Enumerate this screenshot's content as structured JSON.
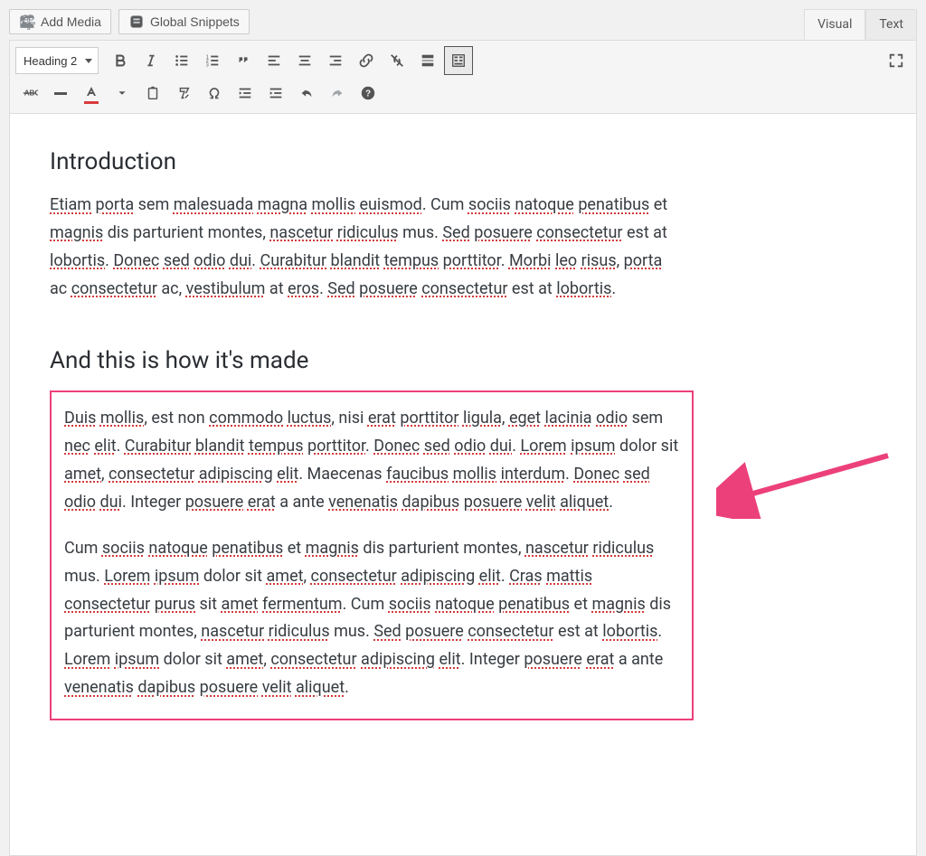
{
  "topbar": {
    "add_media": "Add Media",
    "global_snippets": "Global Snippets"
  },
  "tabs": {
    "visual": "Visual",
    "text": "Text"
  },
  "toolbar": {
    "format": "Heading 2"
  },
  "content": {
    "h1": "Introduction",
    "p1_parts": [
      {
        "t": "Etiam",
        "s": 1
      },
      {
        "t": " ",
        "s": 0
      },
      {
        "t": "porta",
        "s": 1
      },
      {
        "t": " sem ",
        "s": 0
      },
      {
        "t": "malesuada",
        "s": 1
      },
      {
        "t": " ",
        "s": 0
      },
      {
        "t": "magna",
        "s": 1
      },
      {
        "t": " ",
        "s": 0
      },
      {
        "t": "mollis",
        "s": 1
      },
      {
        "t": " ",
        "s": 0
      },
      {
        "t": "euismod",
        "s": 1
      },
      {
        "t": ". Cum ",
        "s": 0
      },
      {
        "t": "sociis",
        "s": 1
      },
      {
        "t": " ",
        "s": 0
      },
      {
        "t": "natoque",
        "s": 1
      },
      {
        "t": " ",
        "s": 0
      },
      {
        "t": "penatibus",
        "s": 1
      },
      {
        "t": " et ",
        "s": 0
      },
      {
        "t": "magnis",
        "s": 1
      },
      {
        "t": " dis parturient montes, ",
        "s": 0
      },
      {
        "t": "nascetur",
        "s": 1
      },
      {
        "t": " ",
        "s": 0
      },
      {
        "t": "ridiculus",
        "s": 1
      },
      {
        "t": " mus. ",
        "s": 0
      },
      {
        "t": "Sed",
        "s": 1
      },
      {
        "t": " ",
        "s": 0
      },
      {
        "t": "posuere",
        "s": 1
      },
      {
        "t": " ",
        "s": 0
      },
      {
        "t": "consectetur",
        "s": 1
      },
      {
        "t": " est at ",
        "s": 0
      },
      {
        "t": "lobortis",
        "s": 1
      },
      {
        "t": ". ",
        "s": 0
      },
      {
        "t": "Donec",
        "s": 1
      },
      {
        "t": " ",
        "s": 0
      },
      {
        "t": "sed",
        "s": 1
      },
      {
        "t": " ",
        "s": 0
      },
      {
        "t": "odio",
        "s": 1
      },
      {
        "t": " ",
        "s": 0
      },
      {
        "t": "dui",
        "s": 1
      },
      {
        "t": ". ",
        "s": 0
      },
      {
        "t": "Curabitur",
        "s": 1
      },
      {
        "t": " ",
        "s": 0
      },
      {
        "t": "blandit",
        "s": 1
      },
      {
        "t": " ",
        "s": 0
      },
      {
        "t": "tempus",
        "s": 1
      },
      {
        "t": " ",
        "s": 0
      },
      {
        "t": "porttitor",
        "s": 1
      },
      {
        "t": ". ",
        "s": 0
      },
      {
        "t": "Morbi",
        "s": 1
      },
      {
        "t": " ",
        "s": 0
      },
      {
        "t": "leo",
        "s": 1
      },
      {
        "t": " ",
        "s": 0
      },
      {
        "t": "risus",
        "s": 1
      },
      {
        "t": ", ",
        "s": 0
      },
      {
        "t": "porta",
        "s": 1
      },
      {
        "t": " ac ",
        "s": 0
      },
      {
        "t": "consectetur",
        "s": 1
      },
      {
        "t": " ac, ",
        "s": 0
      },
      {
        "t": "vestibulum",
        "s": 1
      },
      {
        "t": " at ",
        "s": 0
      },
      {
        "t": "eros",
        "s": 1
      },
      {
        "t": ". ",
        "s": 0
      },
      {
        "t": "Sed",
        "s": 1
      },
      {
        "t": " ",
        "s": 0
      },
      {
        "t": "posuere",
        "s": 1
      },
      {
        "t": " ",
        "s": 0
      },
      {
        "t": "consectetur",
        "s": 1
      },
      {
        "t": " est at ",
        "s": 0
      },
      {
        "t": "lobortis",
        "s": 1
      },
      {
        "t": ".",
        "s": 0
      }
    ],
    "h2": "And this is how it's made",
    "p2_parts": [
      {
        "t": "Duis",
        "s": 1
      },
      {
        "t": " ",
        "s": 0
      },
      {
        "t": "mollis",
        "s": 1
      },
      {
        "t": ", est non ",
        "s": 0
      },
      {
        "t": "commodo",
        "s": 1
      },
      {
        "t": " ",
        "s": 0
      },
      {
        "t": "luctus",
        "s": 1
      },
      {
        "t": ", nisi ",
        "s": 0
      },
      {
        "t": "erat",
        "s": 1
      },
      {
        "t": " ",
        "s": 0
      },
      {
        "t": "porttitor",
        "s": 1
      },
      {
        "t": " ",
        "s": 0
      },
      {
        "t": "ligula",
        "s": 1
      },
      {
        "t": ", ",
        "s": 0
      },
      {
        "t": "eget",
        "s": 1
      },
      {
        "t": " ",
        "s": 0
      },
      {
        "t": "lacinia",
        "s": 1
      },
      {
        "t": " ",
        "s": 0
      },
      {
        "t": "odio",
        "s": 1
      },
      {
        "t": " sem ",
        "s": 0
      },
      {
        "t": "nec",
        "s": 1
      },
      {
        "t": " ",
        "s": 0
      },
      {
        "t": "elit",
        "s": 1
      },
      {
        "t": ". ",
        "s": 0
      },
      {
        "t": "Curabitur",
        "s": 1
      },
      {
        "t": " ",
        "s": 0
      },
      {
        "t": "blandit",
        "s": 1
      },
      {
        "t": " ",
        "s": 0
      },
      {
        "t": "tempus",
        "s": 1
      },
      {
        "t": " ",
        "s": 0
      },
      {
        "t": "porttitor",
        "s": 1
      },
      {
        "t": ". ",
        "s": 0
      },
      {
        "t": "Donec",
        "s": 1
      },
      {
        "t": " ",
        "s": 0
      },
      {
        "t": "sed",
        "s": 1
      },
      {
        "t": " ",
        "s": 0
      },
      {
        "t": "odio",
        "s": 1
      },
      {
        "t": " ",
        "s": 0
      },
      {
        "t": "dui",
        "s": 1
      },
      {
        "t": ". ",
        "s": 0
      },
      {
        "t": "Lorem",
        "s": 1
      },
      {
        "t": " ",
        "s": 0
      },
      {
        "t": "ipsum",
        "s": 1
      },
      {
        "t": " dolor sit ",
        "s": 0
      },
      {
        "t": "amet",
        "s": 1
      },
      {
        "t": ", ",
        "s": 0
      },
      {
        "t": "consectetur",
        "s": 1
      },
      {
        "t": " ",
        "s": 0
      },
      {
        "t": "adipiscing",
        "s": 1
      },
      {
        "t": " ",
        "s": 0
      },
      {
        "t": "elit",
        "s": 1
      },
      {
        "t": ". Maecenas ",
        "s": 0
      },
      {
        "t": "faucibus",
        "s": 1
      },
      {
        "t": " ",
        "s": 0
      },
      {
        "t": "mollis",
        "s": 1
      },
      {
        "t": " ",
        "s": 0
      },
      {
        "t": "interdum",
        "s": 1
      },
      {
        "t": ". ",
        "s": 0
      },
      {
        "t": "Donec",
        "s": 1
      },
      {
        "t": " ",
        "s": 0
      },
      {
        "t": "sed",
        "s": 1
      },
      {
        "t": " ",
        "s": 0
      },
      {
        "t": "odio",
        "s": 1
      },
      {
        "t": " ",
        "s": 0
      },
      {
        "t": "dui",
        "s": 1
      },
      {
        "t": ". Integer ",
        "s": 0
      },
      {
        "t": "posuere",
        "s": 1
      },
      {
        "t": " ",
        "s": 0
      },
      {
        "t": "erat",
        "s": 1
      },
      {
        "t": " a ante ",
        "s": 0
      },
      {
        "t": "venenatis",
        "s": 1
      },
      {
        "t": " ",
        "s": 0
      },
      {
        "t": "dapibus",
        "s": 1
      },
      {
        "t": " ",
        "s": 0
      },
      {
        "t": "posuere",
        "s": 1
      },
      {
        "t": " ",
        "s": 0
      },
      {
        "t": "velit",
        "s": 1
      },
      {
        "t": " ",
        "s": 0
      },
      {
        "t": "aliquet",
        "s": 1
      },
      {
        "t": ".",
        "s": 0
      }
    ],
    "p3_parts": [
      {
        "t": "Cum ",
        "s": 0
      },
      {
        "t": "sociis",
        "s": 1
      },
      {
        "t": " ",
        "s": 0
      },
      {
        "t": "natoque",
        "s": 1
      },
      {
        "t": " ",
        "s": 0
      },
      {
        "t": "penatibus",
        "s": 1
      },
      {
        "t": " et ",
        "s": 0
      },
      {
        "t": "magnis",
        "s": 1
      },
      {
        "t": " dis parturient montes, ",
        "s": 0
      },
      {
        "t": "nascetur",
        "s": 1
      },
      {
        "t": " ",
        "s": 0
      },
      {
        "t": "ridiculus",
        "s": 1
      },
      {
        "t": " mus. ",
        "s": 0
      },
      {
        "t": "Lorem",
        "s": 1
      },
      {
        "t": " ",
        "s": 0
      },
      {
        "t": "ipsum",
        "s": 1
      },
      {
        "t": " dolor sit ",
        "s": 0
      },
      {
        "t": "amet",
        "s": 1
      },
      {
        "t": ", ",
        "s": 0
      },
      {
        "t": "consectetur",
        "s": 1
      },
      {
        "t": " ",
        "s": 0
      },
      {
        "t": "adipiscing",
        "s": 1
      },
      {
        "t": " ",
        "s": 0
      },
      {
        "t": "elit",
        "s": 1
      },
      {
        "t": ". ",
        "s": 0
      },
      {
        "t": "Cras",
        "s": 1
      },
      {
        "t": " ",
        "s": 0
      },
      {
        "t": "mattis",
        "s": 1
      },
      {
        "t": " ",
        "s": 0
      },
      {
        "t": "consectetur",
        "s": 1
      },
      {
        "t": " ",
        "s": 0
      },
      {
        "t": "purus",
        "s": 1
      },
      {
        "t": " sit ",
        "s": 0
      },
      {
        "t": "amet",
        "s": 1
      },
      {
        "t": " ",
        "s": 0
      },
      {
        "t": "fermentum",
        "s": 1
      },
      {
        "t": ". Cum ",
        "s": 0
      },
      {
        "t": "sociis",
        "s": 1
      },
      {
        "t": " ",
        "s": 0
      },
      {
        "t": "natoque",
        "s": 1
      },
      {
        "t": " ",
        "s": 0
      },
      {
        "t": "penatibus",
        "s": 1
      },
      {
        "t": " et ",
        "s": 0
      },
      {
        "t": "magnis",
        "s": 1
      },
      {
        "t": " dis parturient montes, ",
        "s": 0
      },
      {
        "t": "nascetur",
        "s": 1
      },
      {
        "t": " ",
        "s": 0
      },
      {
        "t": "ridiculus",
        "s": 1
      },
      {
        "t": " mus. ",
        "s": 0
      },
      {
        "t": "Sed",
        "s": 1
      },
      {
        "t": " ",
        "s": 0
      },
      {
        "t": "posuere",
        "s": 1
      },
      {
        "t": " ",
        "s": 0
      },
      {
        "t": "consectetur",
        "s": 1
      },
      {
        "t": " est at ",
        "s": 0
      },
      {
        "t": "lobortis",
        "s": 1
      },
      {
        "t": ". ",
        "s": 0
      },
      {
        "t": "Lorem",
        "s": 1
      },
      {
        "t": " ",
        "s": 0
      },
      {
        "t": "ipsum",
        "s": 1
      },
      {
        "t": " dolor sit ",
        "s": 0
      },
      {
        "t": "amet",
        "s": 1
      },
      {
        "t": ", ",
        "s": 0
      },
      {
        "t": "consectetur",
        "s": 1
      },
      {
        "t": " ",
        "s": 0
      },
      {
        "t": "adipiscing",
        "s": 1
      },
      {
        "t": " ",
        "s": 0
      },
      {
        "t": "elit",
        "s": 1
      },
      {
        "t": ". Integer ",
        "s": 0
      },
      {
        "t": "posuere",
        "s": 1
      },
      {
        "t": " ",
        "s": 0
      },
      {
        "t": "erat",
        "s": 1
      },
      {
        "t": " a ante ",
        "s": 0
      },
      {
        "t": "venenatis",
        "s": 1
      },
      {
        "t": " ",
        "s": 0
      },
      {
        "t": "dapibus",
        "s": 1
      },
      {
        "t": " ",
        "s": 0
      },
      {
        "t": "posuere",
        "s": 1
      },
      {
        "t": " ",
        "s": 0
      },
      {
        "t": "velit",
        "s": 1
      },
      {
        "t": " ",
        "s": 0
      },
      {
        "t": "aliquet",
        "s": 1
      },
      {
        "t": ".",
        "s": 0
      }
    ]
  }
}
